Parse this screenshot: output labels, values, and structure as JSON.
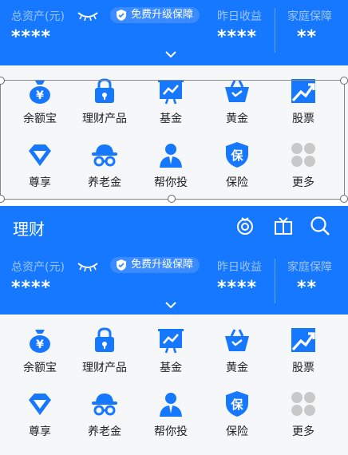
{
  "header": {
    "title": "理财"
  },
  "summary": {
    "total_assets_label": "总资产(元)",
    "total_assets_value": "****",
    "upgrade_label": "免费升级保障",
    "yesterday_label": "昨日收益",
    "yesterday_value": "****",
    "family_label": "家庭保障",
    "family_value": "**"
  },
  "grid": {
    "items": [
      {
        "label": "余额宝",
        "icon": "money-bag-icon"
      },
      {
        "label": "理财产品",
        "icon": "lock-bag-icon"
      },
      {
        "label": "基金",
        "icon": "chart-board-icon"
      },
      {
        "label": "黄金",
        "icon": "basket-icon"
      },
      {
        "label": "股票",
        "icon": "trend-up-icon"
      },
      {
        "label": "尊享",
        "icon": "diamond-icon"
      },
      {
        "label": "养老金",
        "icon": "hat-glasses-icon"
      },
      {
        "label": "帮你投",
        "icon": "advisor-person-icon"
      },
      {
        "label": "保险",
        "icon": "insurance-shield-icon"
      },
      {
        "label": "更多",
        "icon": "more-dots-icon"
      }
    ],
    "insurance_glyph": "保"
  },
  "colors": {
    "accent": "#1677ff",
    "icon": "#1677ff",
    "more_dots": "#c8c8c8"
  }
}
